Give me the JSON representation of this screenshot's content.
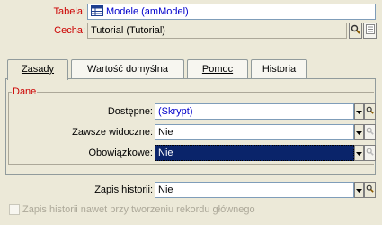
{
  "header": {
    "table_label": "Tabela:",
    "table_value": "Modele (amModel)",
    "field_label": "Cecha:",
    "field_value": "Tutorial (Tutorial)"
  },
  "tabs": [
    {
      "label": "Zasady",
      "active": true
    },
    {
      "label": "Wartość domyślna",
      "active": false
    },
    {
      "label": "Pomoc",
      "active": false
    },
    {
      "label": "Historia",
      "active": false
    }
  ],
  "group": {
    "title": "Dane"
  },
  "rows": {
    "available": {
      "label": "Dostępne:",
      "value": "(Skrypt)"
    },
    "always_visible": {
      "label": "Zawsze widoczne:",
      "value": "Nie"
    },
    "required": {
      "label": "Obowiązkowe:",
      "value": "Nie"
    },
    "history": {
      "label": "Zapis historii:",
      "value": "Nie"
    }
  },
  "checkbox": {
    "label": "Zapis historii nawet przy tworzeniu rekordu głównego",
    "checked": false,
    "enabled": false
  },
  "colors": {
    "label_red": "#cc0000",
    "link_blue": "#0000cc",
    "selection": "#0a246a",
    "window_bg": "#ece9d8"
  }
}
